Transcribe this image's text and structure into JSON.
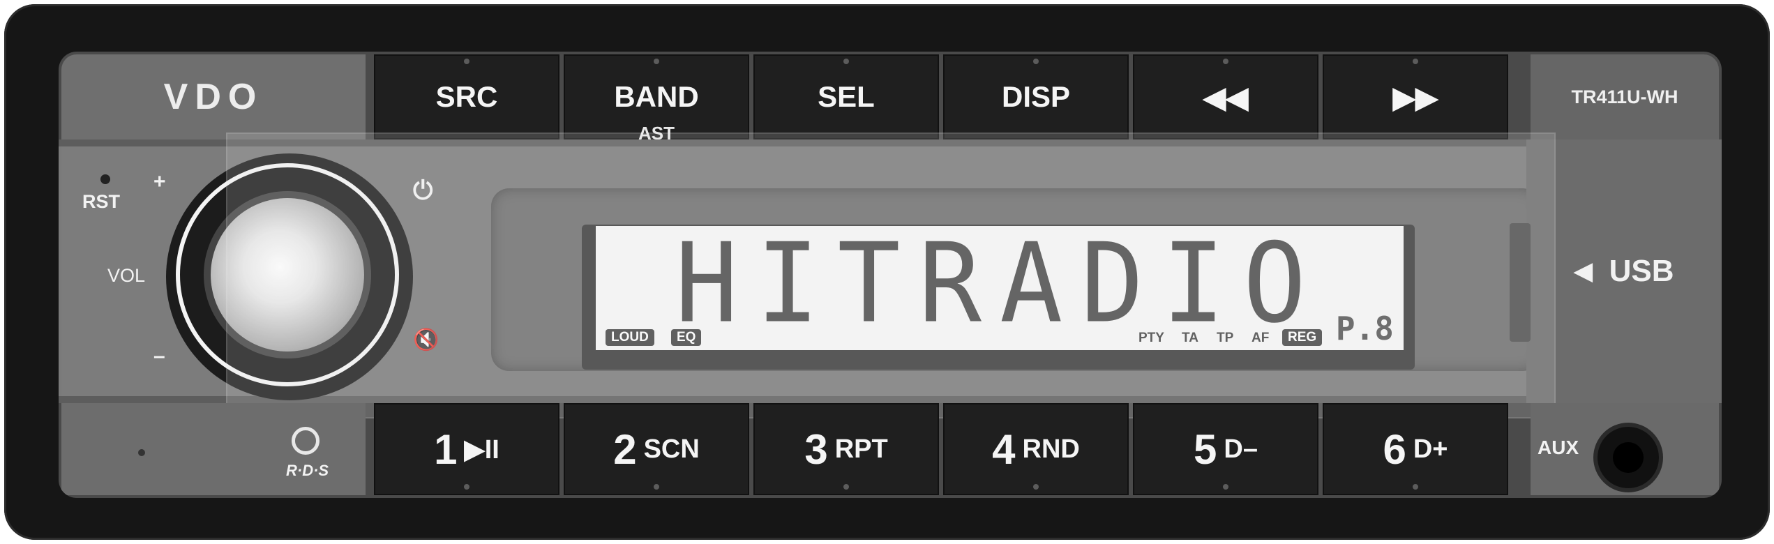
{
  "brand": "VDO",
  "model": "TR411U-WH",
  "top_buttons": [
    {
      "label": "SRC",
      "sub": ""
    },
    {
      "label": "BAND",
      "sub": "AST"
    },
    {
      "label": "SEL",
      "sub": ""
    },
    {
      "label": "DISP",
      "sub": ""
    },
    {
      "label": "◀◀",
      "sub": ""
    },
    {
      "label": "▶▶",
      "sub": ""
    }
  ],
  "bottom_buttons": [
    {
      "num": "1",
      "suffix": "▶II"
    },
    {
      "num": "2",
      "suffix": "SCN"
    },
    {
      "num": "3",
      "suffix": "RPT"
    },
    {
      "num": "4",
      "suffix": "RND"
    },
    {
      "num": "5",
      "suffix": "D–"
    },
    {
      "num": "6",
      "suffix": "D+"
    }
  ],
  "left": {
    "rst": "RST",
    "vol": "VOL",
    "plus": "+",
    "minus": "–"
  },
  "display": {
    "text": "HITRADIO",
    "left_indicators": [
      "LOUD",
      "EQ"
    ],
    "right_indicators": [
      "PTY",
      "TA",
      "TP",
      "AF",
      "REG"
    ],
    "preset": "P.8"
  },
  "usb": {
    "label": "USB",
    "arrow": "◀"
  },
  "aux": {
    "label": "AUX"
  },
  "rds": {
    "label": "R·D·S"
  },
  "icons": {
    "power": "⏻",
    "mute": "🔇"
  }
}
